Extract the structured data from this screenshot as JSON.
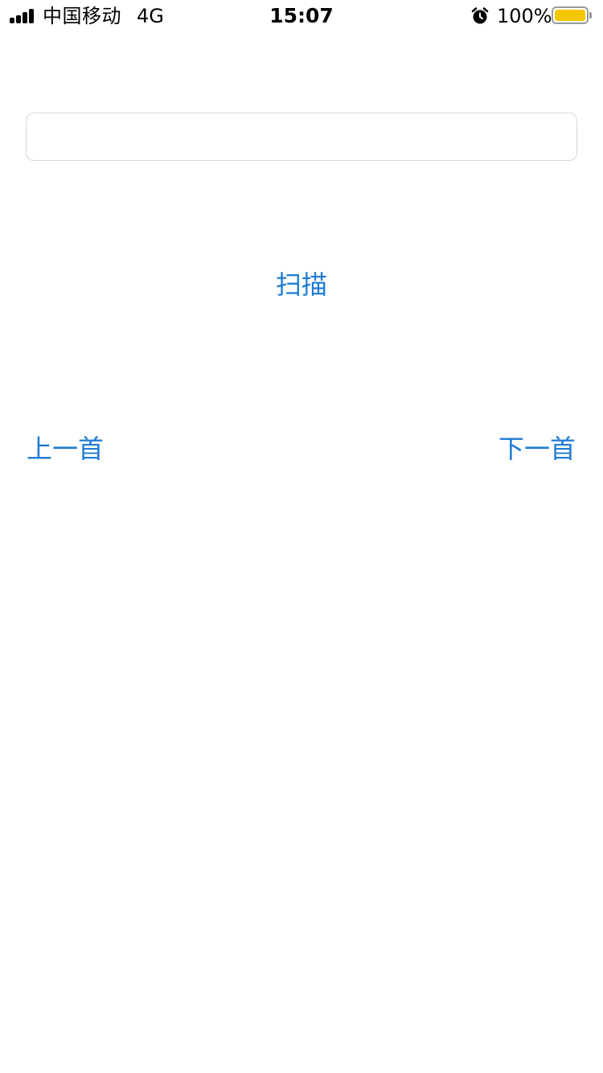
{
  "status_bar": {
    "carrier": "中国移动",
    "network": "4G",
    "time": "15:07",
    "battery_percent": "100%",
    "battery_level": 1.0,
    "signal_bars": 4,
    "alarm_icon": "alarm-clock-icon",
    "battery_color": "#f6c600"
  },
  "input": {
    "value": "",
    "placeholder": ""
  },
  "buttons": {
    "scan_label": "扫描",
    "prev_label": "上一首",
    "next_label": "下一首",
    "accent_color": "#1e7bd4"
  }
}
